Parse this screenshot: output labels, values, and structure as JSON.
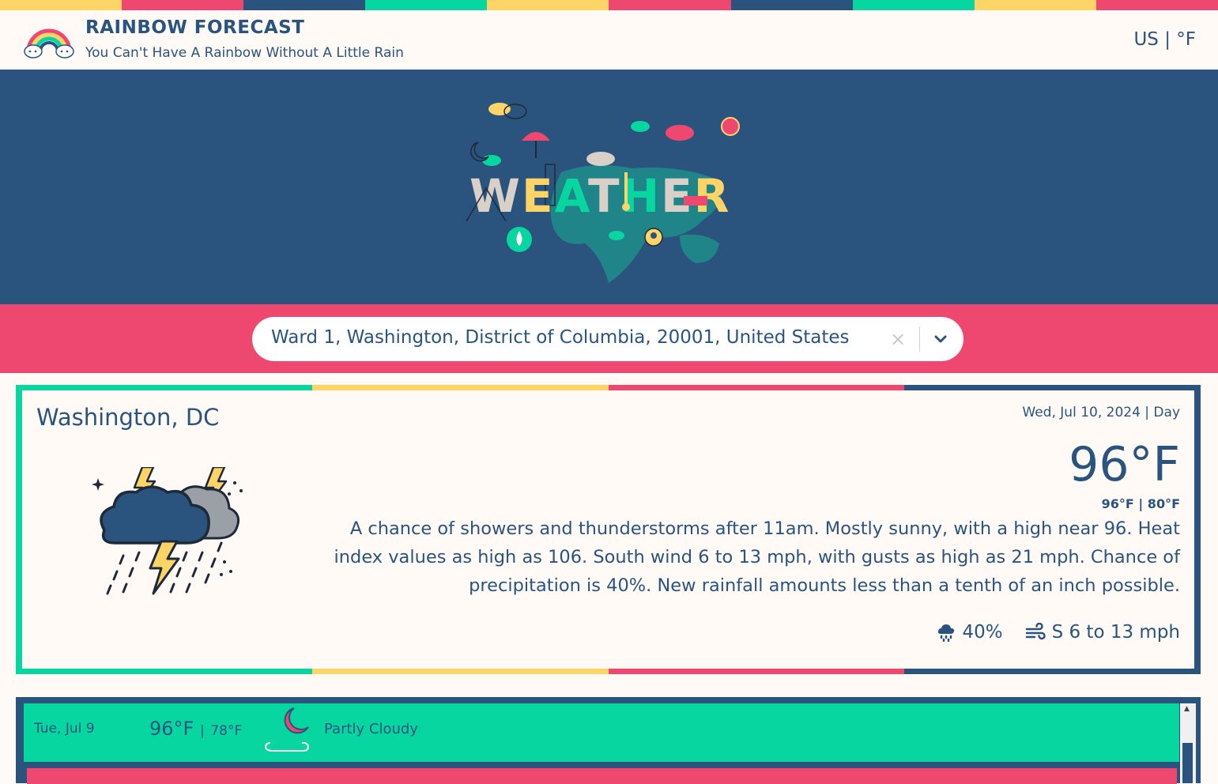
{
  "colors": {
    "green": "#08d6a0",
    "yellow": "#fed467",
    "pink": "#ef4870",
    "navy": "#2a547d",
    "cream": "#fffaf5"
  },
  "header": {
    "title": "RAINBOW FORECAST",
    "tagline": "You Can't Have A Rainbow Without A Little Rain",
    "units": "US | °F",
    "logo_icon": "rainbow-cloud-logo"
  },
  "hero": {
    "artwork": "weather-illustration",
    "art_word": "WEATHER"
  },
  "search": {
    "value": "Ward 1, Washington, District of Columbia, 20001, United States",
    "clear_label": "×",
    "clear_icon": "close-icon",
    "dropdown_icon": "chevron-down-icon"
  },
  "current": {
    "city": "Washington, DC",
    "date": "Wed, Jul 10, 2024 | Day",
    "temp": "96°F",
    "hilo": "96°F | 80°F",
    "description": "A chance of showers and thunderstorms after 11am. Mostly sunny, with a high near 96. Heat index values as high as 106. South wind 6 to 13 mph, with gusts as high as 21 mph. Chance of precipitation is 40%. New rainfall amounts less than a tenth of an inch possible.",
    "condition_icon": "thunderstorm-icon",
    "precip": "40%",
    "precip_icon": "rain-cloud-icon",
    "wind": "S 6 to 13 mph",
    "wind_icon": "wind-icon"
  },
  "forecast": {
    "rows": [
      {
        "date": "Tue, Jul 9",
        "high": "96°F",
        "low": "78°F",
        "sep": "|",
        "icon": "partly-cloudy-night-icon",
        "condition": "Partly Cloudy"
      }
    ],
    "scroll_up_label": "▲"
  }
}
